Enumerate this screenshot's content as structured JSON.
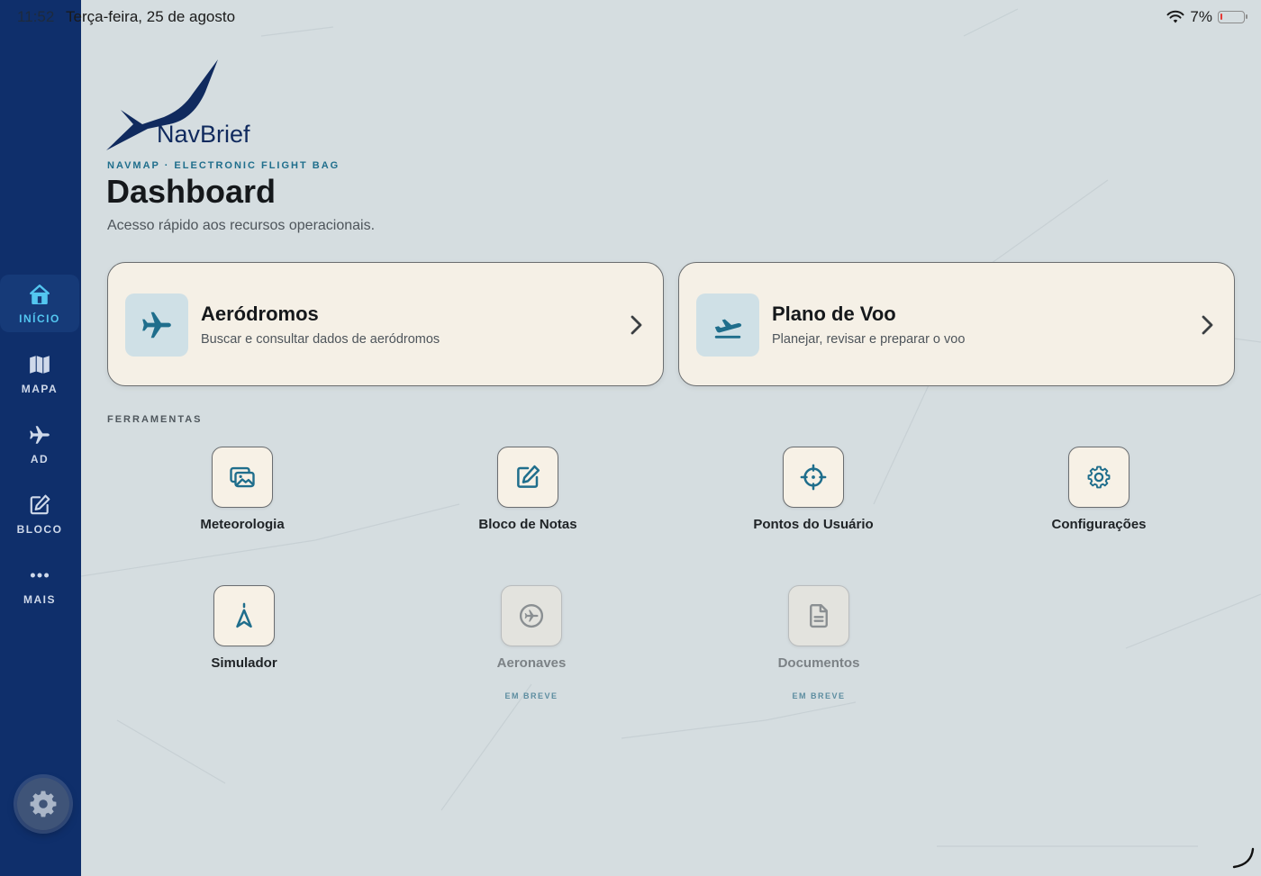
{
  "status_bar": {
    "time": "11:52",
    "date": "Terça-feira, 25 de agosto",
    "battery_percent": "7%",
    "battery_level": 0.07
  },
  "sidebar": {
    "items": [
      {
        "label": "INÍCIO",
        "icon": "home-icon",
        "active": true
      },
      {
        "label": "MAPA",
        "icon": "map-icon",
        "active": false
      },
      {
        "label": "AD",
        "icon": "airplane-icon",
        "active": false
      },
      {
        "label": "BLOCO",
        "icon": "edit-icon",
        "active": false
      },
      {
        "label": "MAIS",
        "icon": "more-icon",
        "active": false
      }
    ],
    "settings_icon": "gear-icon"
  },
  "header": {
    "logo_text": "NavBrief",
    "eyebrow": "NAVMAP · ELECTRONIC FLIGHT BAG",
    "title": "Dashboard",
    "subtitle": "Acesso rápido aos recursos operacionais."
  },
  "cards": [
    {
      "title": "Aeródromos",
      "subtitle": "Buscar e consultar dados de aeródromos",
      "icon": "airplane-icon"
    },
    {
      "title": "Plano de Voo",
      "subtitle": "Planejar, revisar e preparar o voo",
      "icon": "airplane-takeoff-icon"
    }
  ],
  "tools": {
    "section_label": "FERRAMENTAS",
    "items": [
      {
        "label": "Meteorologia",
        "icon": "images-icon",
        "enabled": true
      },
      {
        "label": "Bloco de Notas",
        "icon": "edit-icon",
        "enabled": true
      },
      {
        "label": "Pontos do Usuário",
        "icon": "crosshair-icon",
        "enabled": true
      },
      {
        "label": "Configurações",
        "icon": "gear-icon",
        "enabled": true
      },
      {
        "label": "Simulador",
        "icon": "navigation-icon",
        "enabled": true
      },
      {
        "label": "Aeronaves",
        "icon": "plane-circle-icon",
        "enabled": false,
        "badge": "EM BREVE"
      },
      {
        "label": "Documentos",
        "icon": "document-icon",
        "enabled": false,
        "badge": "EM BREVE"
      }
    ]
  },
  "colors": {
    "sidebar_bg": "#0f2f6b",
    "accent": "#1f6e8c",
    "active_nav": "#53c6f0",
    "card_bg": "#f5f0e6",
    "page_bg": "#d5dde0"
  }
}
